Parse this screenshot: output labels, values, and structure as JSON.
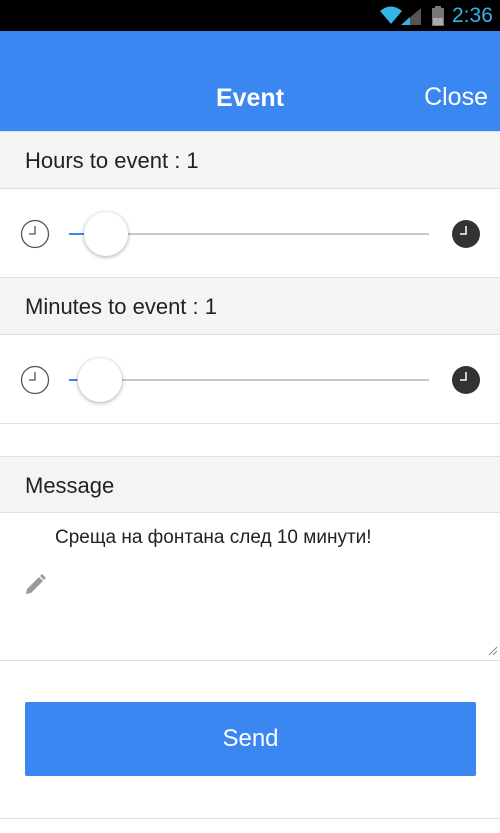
{
  "status_bar": {
    "time": "2:36",
    "icons": [
      "wifi-icon",
      "signal-icon",
      "battery-icon"
    ]
  },
  "header": {
    "title": "Event",
    "close_label": "Close"
  },
  "hours": {
    "label": "Hours to event : 1",
    "value": 1,
    "slider_fraction": 0.06
  },
  "minutes": {
    "label": "Minutes to event : 1",
    "value": 1,
    "slider_fraction": 0.06
  },
  "message": {
    "label": "Message",
    "text": "Среща на фонтана след 10 минути!"
  },
  "send_label": "Send",
  "colors": {
    "accent": "#3a87f1",
    "status_bar": "#000000",
    "status_clock": "#33b5e5",
    "section_bg": "#f4f4f4"
  }
}
